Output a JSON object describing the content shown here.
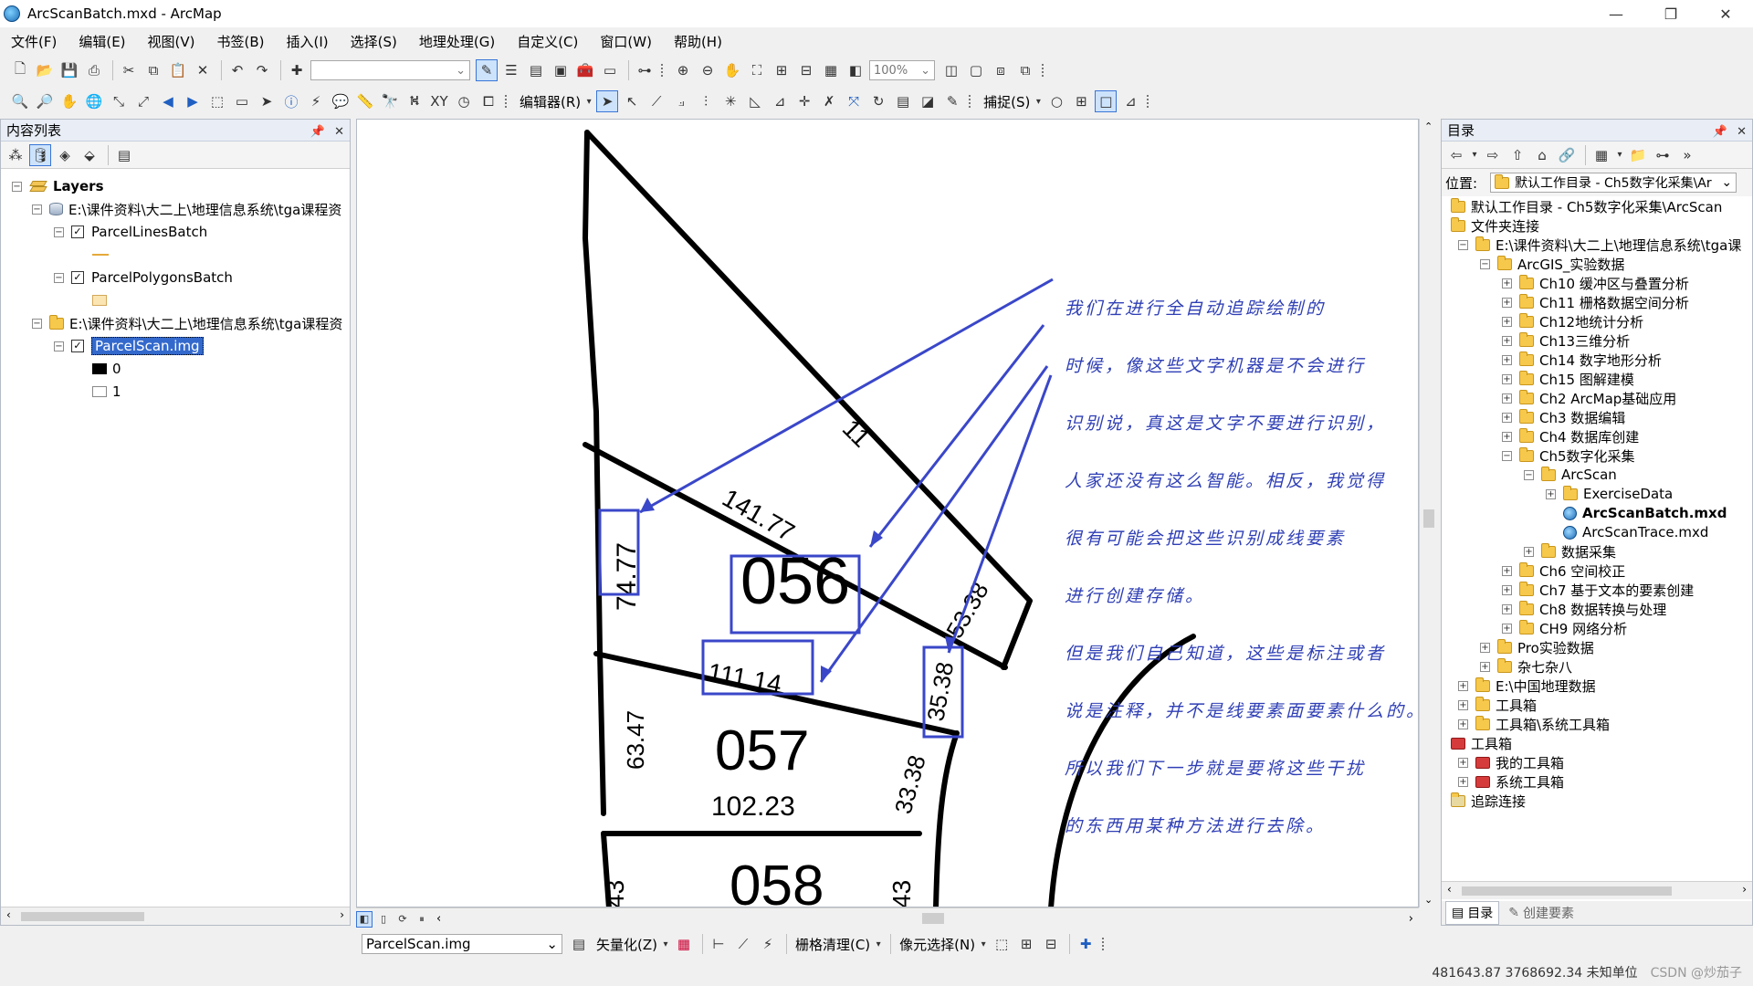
{
  "window": {
    "title": "ArcScanBatch.mxd - ArcMap",
    "controls": [
      "—",
      "❐",
      "✕"
    ]
  },
  "menu": [
    "文件(F)",
    "编辑(E)",
    "视图(V)",
    "书签(B)",
    "插入(I)",
    "选择(S)",
    "地理处理(G)",
    "自定义(C)",
    "窗口(W)",
    "帮助(H)"
  ],
  "toolbar1": {
    "scale_value": "",
    "zoom_value": "100%"
  },
  "toolbar2": {
    "editor_label": "编辑器(R)",
    "snapping_label": "捕捉(S)"
  },
  "toc": {
    "title": "内容列表",
    "items": [
      {
        "label": "Layers"
      },
      {
        "label": "E:\\课件资料\\大二上\\地理信息系统\\tga课程资"
      },
      {
        "label": "ParcelLinesBatch"
      },
      {
        "label": "ParcelPolygonsBatch"
      },
      {
        "label": "E:\\课件资料\\大二上\\地理信息系统\\tga课程资"
      },
      {
        "label": "ParcelScan.img"
      },
      {
        "label": "0"
      },
      {
        "label": "1"
      }
    ]
  },
  "catalog": {
    "title": "目录",
    "location_label": "位置:",
    "location_value": "默认工作目录 - Ch5数字化采集\\Ar",
    "items": [
      {
        "label": "默认工作目录 - Ch5数字化采集\\ArcScan"
      },
      {
        "label": "文件夹连接"
      },
      {
        "label": "E:\\课件资料\\大二上\\地理信息系统\\tga课"
      },
      {
        "label": "ArcGIS_实验数据"
      },
      {
        "label": "Ch10 缓冲区与叠置分析"
      },
      {
        "label": "Ch11 栅格数据空间分析"
      },
      {
        "label": "Ch12地统计分析"
      },
      {
        "label": "Ch13三维分析"
      },
      {
        "label": "Ch14 数字地形分析"
      },
      {
        "label": "Ch15 图解建模"
      },
      {
        "label": "Ch2  ArcMap基础应用"
      },
      {
        "label": "Ch3 数据编辑"
      },
      {
        "label": "Ch4 数据库创建"
      },
      {
        "label": "Ch5数字化采集"
      },
      {
        "label": "ArcScan"
      },
      {
        "label": "ExerciseData"
      },
      {
        "label": "ArcScanBatch.mxd"
      },
      {
        "label": "ArcScanTrace.mxd"
      },
      {
        "label": "数据采集"
      },
      {
        "label": "Ch6 空间校正"
      },
      {
        "label": "Ch7 基于文本的要素创建"
      },
      {
        "label": "Ch8 数据转换与处理"
      },
      {
        "label": "CH9 网络分析"
      },
      {
        "label": "Pro实验数据"
      },
      {
        "label": "杂七杂八"
      },
      {
        "label": "E:\\中国地理数据"
      },
      {
        "label": "工具箱"
      },
      {
        "label": "工具箱\\系统工具箱"
      },
      {
        "label": "工具箱"
      },
      {
        "label": "我的工具箱"
      },
      {
        "label": "系统工具箱"
      },
      {
        "label": "追踪连接"
      }
    ],
    "tabs": [
      "目录",
      "创建要素"
    ]
  },
  "map": {
    "parcel_labels": [
      "056",
      "057",
      "058"
    ],
    "dimension_labels": [
      "74.77",
      "141.77",
      "111.14",
      "102.23",
      "63.47",
      "33.38",
      "35.38",
      "53.38",
      "11",
      "43",
      "43"
    ],
    "annotation_lines": [
      "我们在进行全自动追踪绘制的",
      "时候，像这些文字机器是不会进行",
      "识别说，真这是文字不要进行识别，",
      "人家还没有这么智能。相反，我觉得",
      "很有可能会把这些识别成线要素",
      "进行创建存储。",
      "但是我们自己知道，这些是标注或者",
      "说是注释，并不是线要素面要素什么的。",
      "所以我们下一步就是要将这些干扰",
      "的东西用某种方法进行去除。"
    ],
    "annotation_color": "#3a47c9"
  },
  "vectorization_toolbar": {
    "raster_layer": "ParcelScan.img",
    "vectorize_label": "矢量化(Z)",
    "raster_cleanup_label": "栅格清理(C)",
    "cell_selection_label": "像元选择(N)"
  },
  "status": {
    "coordinates": "481643.87  3768692.34 未知单位",
    "watermark": "CSDN @炒茄子"
  }
}
